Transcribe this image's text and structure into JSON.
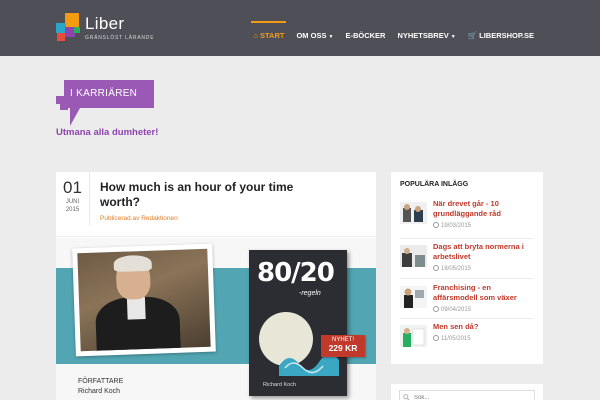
{
  "brand": {
    "name": "Liber",
    "tagline": "GRÄNSLÖST LÄRANDE",
    "colors": {
      "header": "#4f5057",
      "accent": "#f39c12",
      "purple": "#8e44ad",
      "link": "#c0392b"
    }
  },
  "nav": {
    "items": [
      {
        "label": "START",
        "icon": "home-icon",
        "active": true
      },
      {
        "label": "OM OSS",
        "dropdown": true
      },
      {
        "label": "E-BÖCKER"
      },
      {
        "label": "NYHETSBREV",
        "dropdown": true
      },
      {
        "label": "LIBERSHOP.SE",
        "icon": "cart-icon"
      }
    ]
  },
  "category": {
    "title": "I KARRIÄREN",
    "tagline": "Utmana alla dumheter!"
  },
  "article": {
    "date": {
      "day": "01",
      "month": "JUNI",
      "year": "2015"
    },
    "title": "How much is an hour of your time worth?",
    "meta_prefix": "Publicerad av",
    "author": "Redaktionen",
    "image": {
      "book_title": "80/20",
      "book_subtitle": "-regeln",
      "book_author": "Richard Koch",
      "badge_label": "NYHET!",
      "badge_price": "229 KR",
      "author_label": "FÖRFATTARE",
      "author_name": "Richard Koch"
    }
  },
  "sidebar": {
    "title": "POPULÄRA INLÄGG",
    "posts": [
      {
        "title": "När drevet går - 10 grundläggande råd",
        "date": "19/03/2015"
      },
      {
        "title": "Dags att bryta normerna i arbetslivet",
        "date": "18/05/2015"
      },
      {
        "title": "Franchising - en affärsmodell som växer",
        "date": "09/04/2015"
      },
      {
        "title": "Men sen då?",
        "date": "11/05/2015"
      }
    ]
  },
  "search": {
    "placeholder": "Sök..."
  }
}
